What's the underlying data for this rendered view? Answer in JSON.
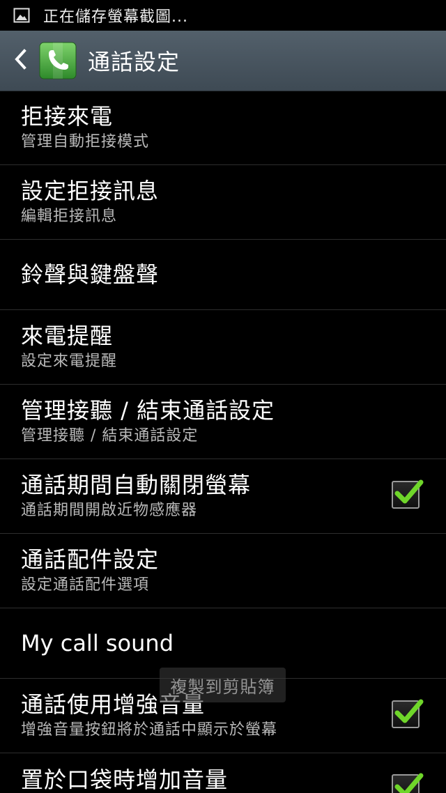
{
  "status_bar": {
    "icon": "image-icon",
    "text": "正在儲存螢幕截圖..."
  },
  "action_bar": {
    "back_icon": "chevron-left-icon",
    "app_icon": "phone-icon",
    "title": "通話設定",
    "accent_color": "#4cb848"
  },
  "settings": [
    {
      "title": "拒接來電",
      "subtitle": "管理自動拒接模式"
    },
    {
      "title": "設定拒接訊息",
      "subtitle": "編輯拒接訊息"
    },
    {
      "title": "鈴聲與鍵盤聲"
    },
    {
      "title": "來電提醒",
      "subtitle": "設定來電提醒"
    },
    {
      "title": "管理接聽 / 結束通話設定",
      "subtitle": "管理接聽 / 結束通話設定"
    },
    {
      "title": "通話期間自動關閉螢幕",
      "subtitle": "通話期間開啟近物感應器",
      "checked": true
    },
    {
      "title": "通話配件設定",
      "subtitle": "設定通話配件選項"
    },
    {
      "title": "My call sound"
    },
    {
      "title": "通話使用增強音量",
      "subtitle": "增強音量按鈕將於通話中顯示於螢幕",
      "checked": true
    },
    {
      "title": "置於口袋時增加音量",
      "checked": true
    }
  ],
  "toast": {
    "text": "複製到剪貼簿"
  }
}
